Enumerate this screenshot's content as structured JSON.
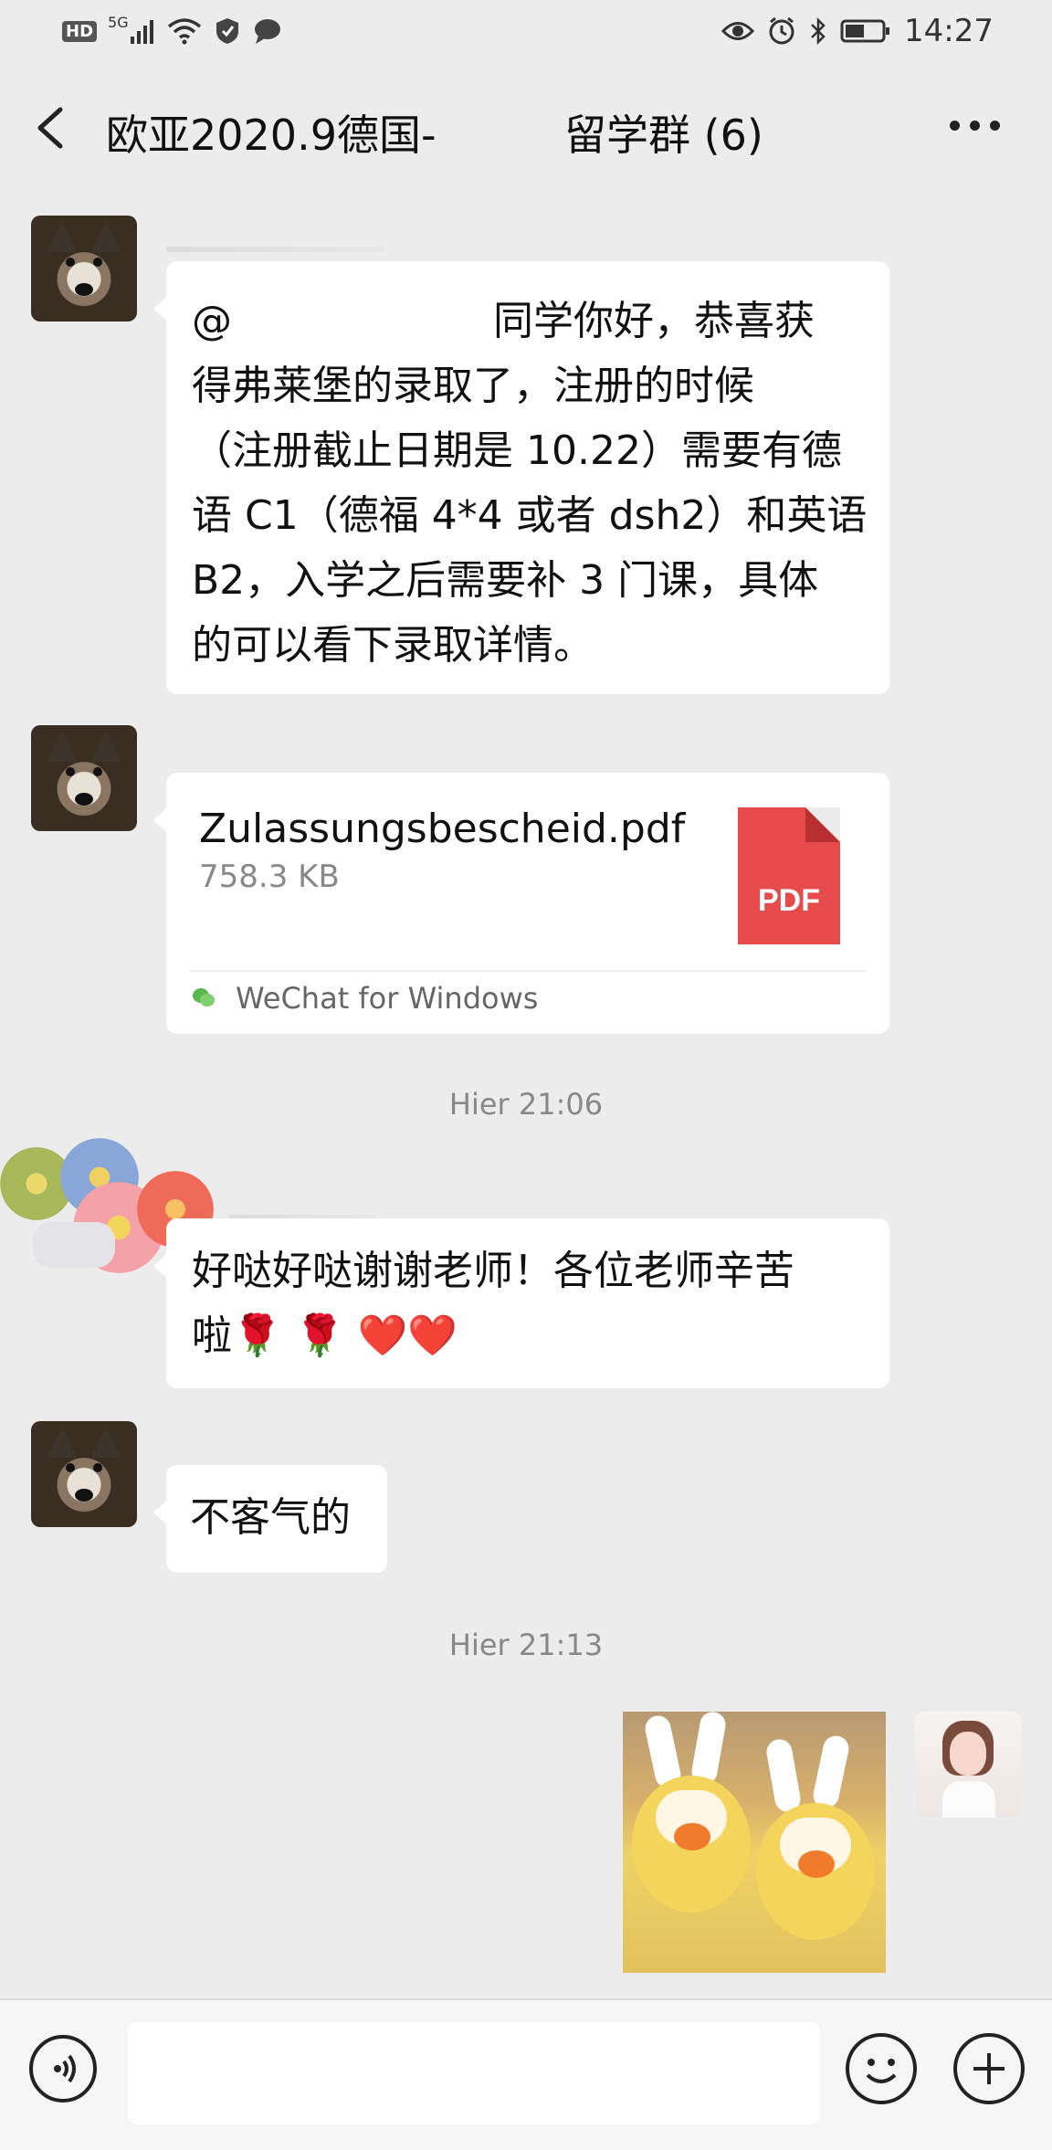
{
  "status_bar": {
    "hd": "HD",
    "network": "5G",
    "time": "14:27",
    "icons": [
      "hd-icon",
      "signal-icon",
      "wifi-icon",
      "shield-icon",
      "message-icon",
      "eye-icon",
      "alarm-icon",
      "bluetooth-icon",
      "battery-icon"
    ]
  },
  "header": {
    "title_left": "欧亚2020.9德国-",
    "title_right": "留学群 (6)",
    "back_icon": "chevron-left-icon",
    "more_icon": "more-icon"
  },
  "messages": [
    {
      "type": "text",
      "mention": "@",
      "text": "同学你好，恭喜获\n得弗莱堡的录取了，注册的时候\n（注册截止日期是 10.22）需要有德\n语 C1（德福 4*4 或者 dsh2）和英语\nB2，入学之后需要补 3 门课，具体\n的可以看下录取详情。"
    },
    {
      "type": "file",
      "file_name": "Zulassungsbescheid.pdf",
      "file_size": "758.3 KB",
      "file_badge": "PDF",
      "source": "WeChat for Windows"
    },
    {
      "type": "timestamp",
      "text": "Hier 21:06"
    },
    {
      "type": "text",
      "text": "好哒好哒谢谢老师！各位老师辛苦\n啦🌹 🌹 ❤️❤️"
    },
    {
      "type": "text",
      "text": "不客气的"
    },
    {
      "type": "timestamp",
      "text": "Hier 21:13"
    },
    {
      "type": "sticker",
      "sticker_name": "duck-sticker"
    }
  ],
  "input_bar": {
    "voice_icon": "voice-icon",
    "emoji_icon": "emoji-icon",
    "plus_icon": "plus-icon",
    "text_value": ""
  },
  "colors": {
    "background": "#ececec",
    "bubble": "#ffffff",
    "pdf_red": "#e64a4a",
    "timestamp": "#888888"
  }
}
